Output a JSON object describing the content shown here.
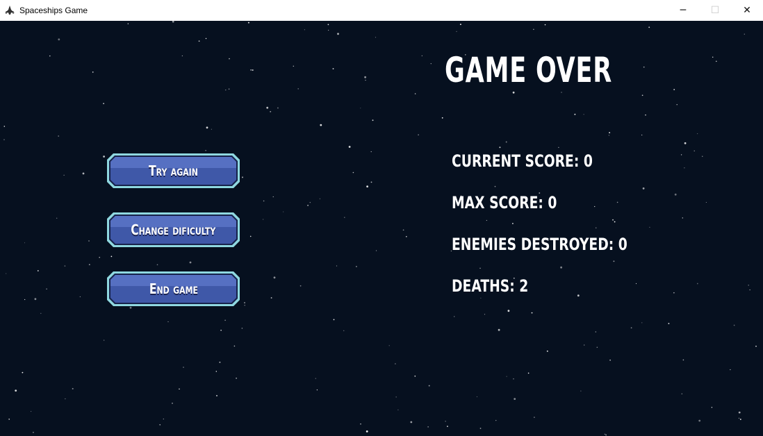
{
  "window": {
    "title": "Spaceships Game",
    "controls": {
      "minimize": "─",
      "maximize": "☐",
      "close": "✕"
    }
  },
  "game_over": {
    "heading": "GAME OVER",
    "stats": [
      "CURRENT SCORE: 0",
      "MAX SCORE: 0",
      "ENEMIES DESTROYED: 0",
      "DEATHS: 2"
    ]
  },
  "menu": {
    "try_again": "Try again",
    "change_difficulty": "Change dificulty",
    "end_game": "End game"
  },
  "colors": {
    "background": "#06101f",
    "button_border": "#8fd8e0",
    "button_fill": "#3f58a8",
    "text": "#ffffff"
  }
}
